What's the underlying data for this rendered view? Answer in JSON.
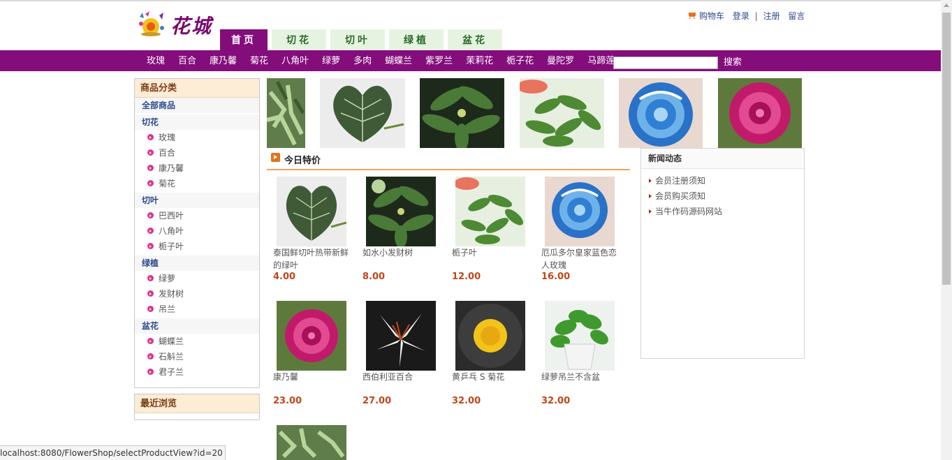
{
  "site": {
    "logo_text": "花城"
  },
  "top_links": {
    "cart": "购物车",
    "login": "登录",
    "separator": "|",
    "register": "注册",
    "message": "留言"
  },
  "tabs": [
    {
      "label": "首页",
      "active": true
    },
    {
      "label": "切花",
      "active": false
    },
    {
      "label": "切叶",
      "active": false
    },
    {
      "label": "绿植",
      "active": false
    },
    {
      "label": "盆花",
      "active": false
    }
  ],
  "nav": {
    "categories": [
      "玫瑰",
      "百合",
      "康乃馨",
      "菊花",
      "八角叶",
      "绿萝",
      "多肉",
      "蝴蝶兰",
      "紫罗兰",
      "茉莉花",
      "栀子花",
      "曼陀罗",
      "马蹄莲"
    ],
    "search_value": "",
    "search_label": "搜索"
  },
  "sidebar": {
    "title": "商品分类",
    "all": "全部商品",
    "groups": [
      {
        "name": "切花",
        "items": [
          "玫瑰",
          "百合",
          "康乃馨",
          "菊花"
        ]
      },
      {
        "name": "切叶",
        "items": [
          "巴西叶",
          "八角叶",
          "栀子叶"
        ]
      },
      {
        "name": "绿植",
        "items": [
          "绿萝",
          "发财树",
          "吊兰"
        ]
      },
      {
        "name": "盆花",
        "items": [
          "蝴蝶兰",
          "石斛兰",
          "君子兰"
        ]
      }
    ],
    "recent_title": "最近浏览"
  },
  "carousel": [
    "green-leaf",
    "anthurium-leaf",
    "money-tree",
    "gardenia-leaf",
    "blue-rose",
    "peony"
  ],
  "special": {
    "title": "今日特价",
    "products": [
      {
        "name": "泰国鲜切叶热带新鲜的绿叶",
        "price": "4.00",
        "image": "anthurium-leaf"
      },
      {
        "name": "如水小发财树",
        "price": "8.00",
        "image": "money-tree"
      },
      {
        "name": "栀子叶",
        "price": "12.00",
        "image": "gardenia-leaf"
      },
      {
        "name": "厄瓜多尔皇家蓝色恋人玫瑰",
        "price": "16.00",
        "image": "blue-rose"
      },
      {
        "name": "康乃馨",
        "price": "23.00",
        "image": "peony"
      },
      {
        "name": "西伯利亚百合",
        "price": "27.00",
        "image": "white-lily"
      },
      {
        "name": "黄乒乓 S 菊花",
        "price": "32.00",
        "image": "yellow-chrysanthemum"
      },
      {
        "name": "绿萝吊兰不含盆",
        "price": "32.00",
        "image": "pothos-pot"
      },
      {
        "name": "",
        "price": "",
        "image": "green-leaf"
      }
    ]
  },
  "news": {
    "title": "新闻动态",
    "items": [
      "会员注册须知",
      "会员购买须知",
      "当牛作码源码网站"
    ]
  },
  "status_url": "localhost:8080/FlowerShop/selectProductView?id=20"
}
